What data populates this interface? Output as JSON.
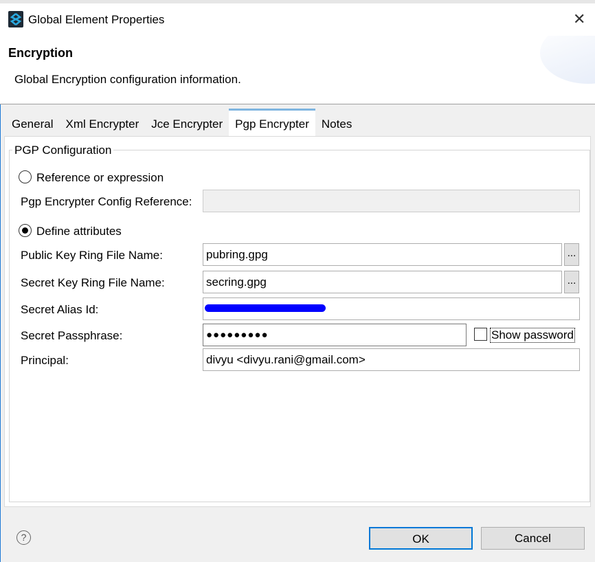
{
  "window": {
    "title": "Global Element Properties"
  },
  "header": {
    "title": "Encryption",
    "description": "Global Encryption configuration information."
  },
  "tabs": [
    {
      "label": "General"
    },
    {
      "label": "Xml Encrypter"
    },
    {
      "label": "Jce Encrypter"
    },
    {
      "label": "Pgp Encrypter",
      "active": true
    },
    {
      "label": "Notes"
    }
  ],
  "group": {
    "title": "PGP Configuration",
    "radio_reference": "Reference or expression",
    "config_ref_label": "Pgp Encrypter Config Reference:",
    "config_ref_value": "",
    "radio_define": "Define attributes",
    "public_key_label": "Public Key Ring File Name:",
    "public_key_value": "pubring.gpg",
    "secret_key_label": "Secret Key Ring File Name:",
    "secret_key_value": "secring.gpg",
    "browse": "...",
    "alias_label": "Secret Alias Id:",
    "passphrase_label": "Secret Passphrase:",
    "passphrase_value": "●●●●●●●●●",
    "show_password": "Show password",
    "principal_label": "Principal:",
    "principal_value": "divyu <divyu.rani@gmail.com>"
  },
  "footer": {
    "help": "?",
    "ok": "OK",
    "cancel": "Cancel"
  }
}
